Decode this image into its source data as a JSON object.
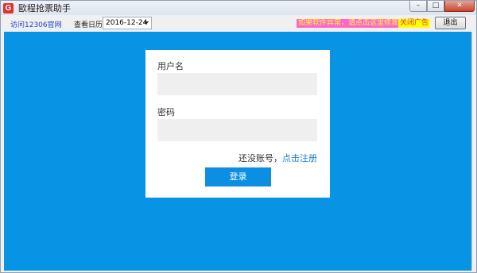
{
  "window": {
    "title": "歐程抢票助手",
    "logo_letter": "G",
    "min_glyph": "–",
    "max_glyph": "□",
    "close_glyph": "✕"
  },
  "toolbar": {
    "official_link": "访问12306官网",
    "calendar_label": "查看日历",
    "date_value": "2016-12-24",
    "ad_text": "如果软件异常，请点击这里修复！",
    "close_ad": "关闭广告",
    "exit_label": "退出"
  },
  "login": {
    "username_label": "用户名",
    "username_value": "",
    "password_label": "密码",
    "password_value": "",
    "no_account_text": "还没账号，",
    "register_link": "点击注册",
    "login_button": "登录"
  }
}
